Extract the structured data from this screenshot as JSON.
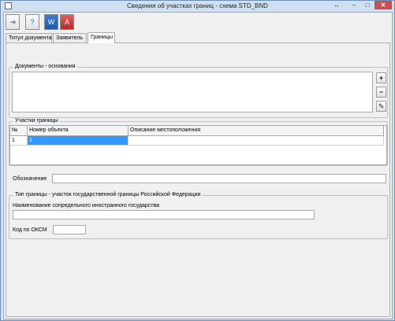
{
  "window": {
    "title": "Сведения об участках границ - схема STD_BND",
    "resize_glyph": "↔",
    "min_glyph": "–",
    "max_glyph": "□",
    "close_glyph": "✕"
  },
  "toolbar": {
    "buttons": [
      {
        "name": "exit-icon",
        "glyph": "⇥"
      },
      {
        "name": "help-icon",
        "glyph": "?"
      },
      {
        "name": "word-icon",
        "glyph": "W"
      },
      {
        "name": "pdf-icon",
        "glyph": "A"
      }
    ]
  },
  "tabs": [
    {
      "label": "Титул документа"
    },
    {
      "label": "Заявитель"
    },
    {
      "label": "Границы"
    }
  ],
  "documents": {
    "group_label": "Документы - основания",
    "add_glyph": "+",
    "remove_glyph": "−",
    "edit_glyph": "✎"
  },
  "sections": {
    "group_label": "Участки границы",
    "columns": [
      "№",
      "Номер объекта",
      "Описание местоположения"
    ],
    "rows": [
      {
        "num": "1",
        "object_number": "1",
        "description": ""
      }
    ]
  },
  "designation": {
    "label": "Обозначение",
    "value": ""
  },
  "border_type": {
    "group_label": "Тип границы - участок государственной границы Российской Федерации",
    "state_label": "Наименование сопредельного иностранного государства",
    "state_value": "",
    "oksm_label": "Код по ОКСМ",
    "oksm_value": ""
  },
  "colors": {
    "selection": "#3399ff",
    "close_button": "#c75050"
  }
}
